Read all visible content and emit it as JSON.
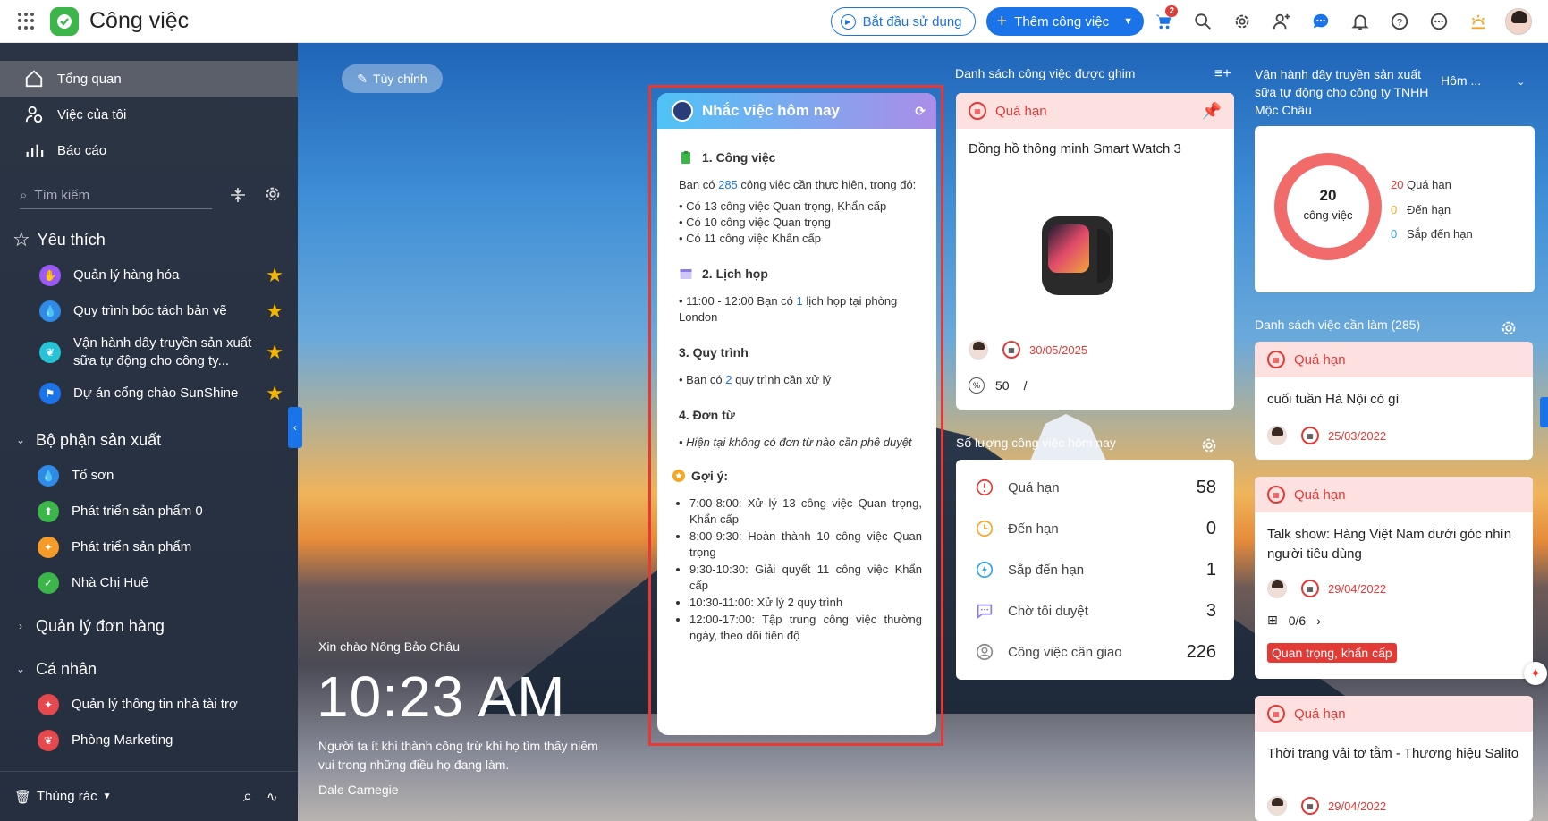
{
  "app": {
    "title": "Công việc",
    "brand_color": "#3cb54a",
    "accent": "#1a73e8"
  },
  "topbar": {
    "start_label": "Bắt đầu sử dụng",
    "add_label": "Thêm công việc",
    "cart_badge": "2",
    "icons": [
      "cart-icon",
      "search-icon",
      "gear-icon",
      "add-user-icon",
      "chat-icon",
      "bell-icon",
      "help-icon",
      "more-icon",
      "sun-icon",
      "avatar"
    ]
  },
  "sidebar": {
    "nav": [
      {
        "label": "Tổng quan",
        "icon": "home-icon"
      },
      {
        "label": "Việc của tôi",
        "icon": "user-check-icon"
      },
      {
        "label": "Báo cáo",
        "icon": "bar-chart-icon"
      }
    ],
    "search_placeholder": "Tìm kiếm",
    "favorites": {
      "title": "Yêu thích",
      "items": [
        {
          "label": "Quản lý hàng hóa",
          "color": "#9b59f5"
        },
        {
          "label": "Quy trình bóc tách bản vẽ",
          "color": "#2f8be6"
        },
        {
          "label": "Vận hành dây truyền sản xuất sữa tự động cho công ty...",
          "color": "#27c2d6"
        },
        {
          "label": "Dự án cổng chào SunShine",
          "color": "#1a73e8"
        }
      ]
    },
    "production": {
      "title": "Bộ phận sản xuất",
      "items": [
        {
          "label": "Tổ sơn",
          "color": "#2f8be6"
        },
        {
          "label": "Phát triển sản phẩm 0",
          "color": "#3cb54a"
        },
        {
          "label": "Phát triển sản phẩm",
          "color": "#f59b2a"
        },
        {
          "label": "Nhà Chị Huệ",
          "color": "#3cb54a"
        }
      ]
    },
    "orders": {
      "title": "Quản lý đơn hàng"
    },
    "personal": {
      "title": "Cá nhân",
      "items": [
        {
          "label": "Quản lý thông tin nhà tài trợ",
          "color": "#e5484d"
        },
        {
          "label": "Phòng Marketing",
          "color": "#e5484d"
        }
      ]
    },
    "trash_label": "Thùng rác"
  },
  "dashboard": {
    "customize_label": "Tùy chỉnh",
    "greeting": "Xin chào Nông Bảo Châu",
    "clock": "10:23 AM",
    "quote": "Người ta ít khi thành công trừ khi họ tìm thấy niềm vui trong những điều họ đang làm.",
    "author": "Dale Carnegie"
  },
  "reminder": {
    "title": "Nhắc việc hôm nay",
    "s1_title": "1. Công việc",
    "s1_pre": "Bạn có ",
    "s1_num": "285",
    "s1_post": " công việc cần thực hiện, trong đó:",
    "s1_items": [
      "• Có 13 công việc Quan trọng, Khẩn cấp",
      "• Có 10 công việc Quan trọng",
      "• Có 11 công việc Khẩn cấp"
    ],
    "s2_title": "2. Lịch họp",
    "s2_pre": "• 11:00 - 12:00 Bạn có ",
    "s2_num": "1",
    "s2_post": " lịch họp tại phòng London",
    "s3_title": "3. Quy trình",
    "s3_pre": "• Bạn có ",
    "s3_num": "2",
    "s3_post": " quy trình cần xử lý",
    "s4_title": "4. Đơn từ",
    "s4_text": "• Hiện tại không có đơn từ nào cần phê duyệt",
    "suggest_title": "Gợi ý:",
    "suggestions": [
      "7:00-8:00: Xử lý 13 công việc Quan trọng, Khẩn cấp",
      "8:00-9:30: Hoàn thành 10 công việc Quan trọng",
      "9:30-10:30: Giải quyết 11 công việc Khẩn cấp",
      "10:30-11:00: Xử lý 2 quy trình",
      "12:00-17:00: Tập trung công việc thường ngày, theo dõi tiến độ"
    ]
  },
  "pinned": {
    "title": "Danh sách công việc được ghim",
    "status": "Quá hạn",
    "task": "Đồng hồ thông minh Smart Watch 3",
    "date": "30/05/2025",
    "progress": "50",
    "progress_sep": "/"
  },
  "today_counts": {
    "title": "Số lượng công việc hôm nay",
    "rows": [
      {
        "label": "Quá hạn",
        "value": "58",
        "icon": "alert-icon"
      },
      {
        "label": "Đến hạn",
        "value": "0",
        "icon": "clock-icon"
      },
      {
        "label": "Sắp đến hạn",
        "value": "1",
        "icon": "flash-icon"
      },
      {
        "label": "Chờ tôi duyệt",
        "value": "3",
        "icon": "comment-icon"
      },
      {
        "label": "Công việc cần giao",
        "value": "226",
        "icon": "person-icon"
      }
    ]
  },
  "project": {
    "title": "Vận hành dây truyền sản xuất sữa tự động cho công ty TNHH Mộc Châu",
    "period": "Hôm ...",
    "total": "20",
    "total_unit": "công việc",
    "legend": [
      {
        "num": "20",
        "label": "Quá hạn",
        "color": "#e53935"
      },
      {
        "num": "0",
        "label": "Đến hạn",
        "color": "#f5a623"
      },
      {
        "num": "0",
        "label": "Sắp đến hạn",
        "color": "#2fa4e7"
      }
    ]
  },
  "todo": {
    "title": "Danh sách việc cần làm (285)",
    "items": [
      {
        "status": "Quá hạn",
        "title": "cuối tuần Hà Nội có gì",
        "date": "25/03/2022"
      },
      {
        "status": "Quá hạn",
        "title": "Talk show: Hàng Việt Nam dưới góc nhìn người tiêu dùng",
        "date": "29/04/2022",
        "subtasks": "0/6",
        "tag": "Quan trọng, khẩn cấp"
      },
      {
        "status": "Quá hạn",
        "title": "Thời trang vải tơ tằm - Thương hiệu Salito",
        "date": "29/04/2022"
      }
    ]
  }
}
